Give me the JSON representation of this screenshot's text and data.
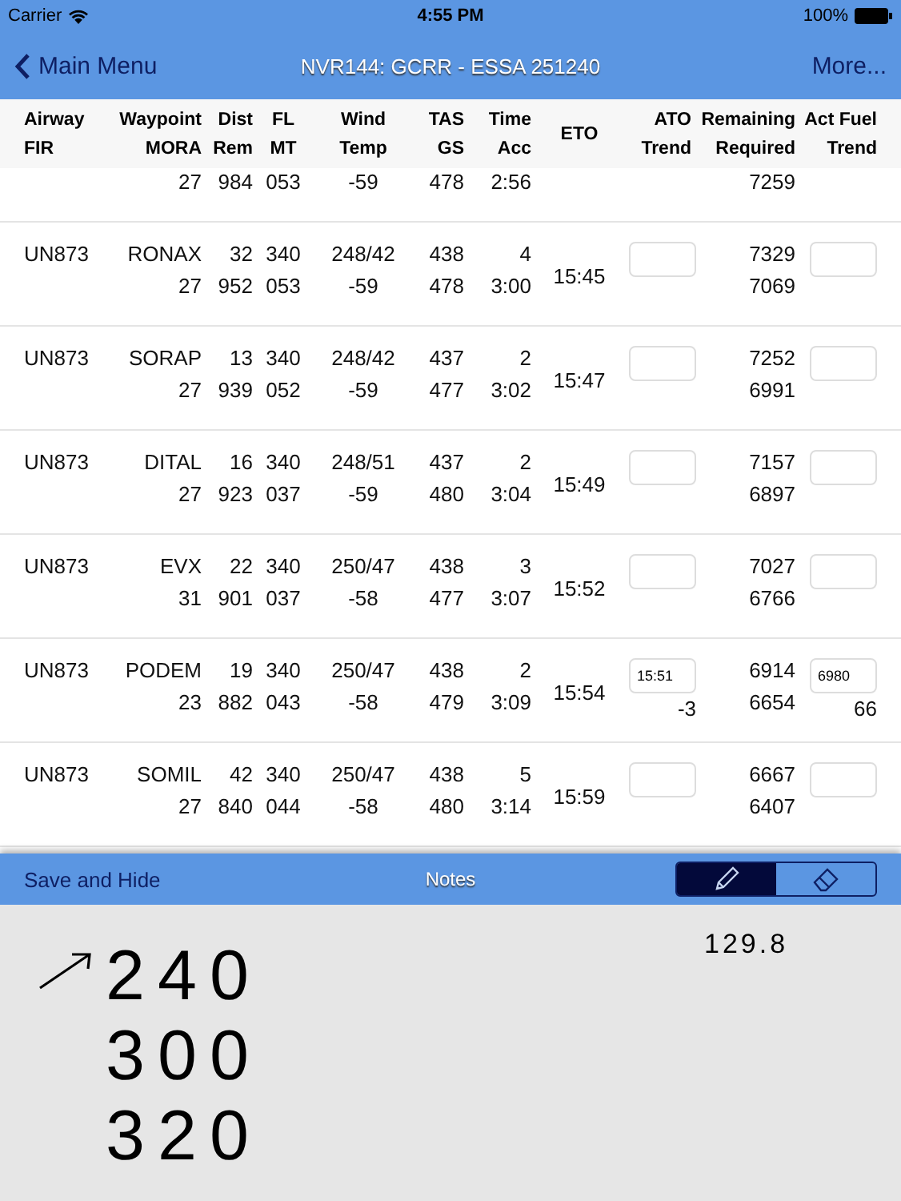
{
  "status_bar": {
    "carrier": "Carrier",
    "time": "4:55 PM",
    "battery": "100%"
  },
  "nav": {
    "back": "Main Menu",
    "title": "NVR144: GCRR - ESSA 251240",
    "more": "More..."
  },
  "columns": [
    {
      "top": "Airway",
      "bottom": "FIR"
    },
    {
      "top": "Waypoint",
      "bottom": "MORA"
    },
    {
      "top": "Dist",
      "bottom": "Rem"
    },
    {
      "top": "FL",
      "bottom": "MT"
    },
    {
      "top": "Wind",
      "bottom": "Temp"
    },
    {
      "top": "TAS",
      "bottom": "GS"
    },
    {
      "top": "Time",
      "bottom": "Acc"
    },
    {
      "top": "ETO"
    },
    {
      "top": "ATO",
      "bottom": "Trend"
    },
    {
      "top": "Remaining",
      "bottom": "Required"
    },
    {
      "top": "Act Fuel",
      "bottom": "Trend"
    }
  ],
  "clipped_row": {
    "mora": "27",
    "rem": "984",
    "mt": "053",
    "temp": "-59",
    "gs": "478",
    "acc": "2:56",
    "required": "7259"
  },
  "rows": [
    {
      "airway": "UN873",
      "waypoint": "RONAX",
      "mora": "27",
      "dist": "32",
      "rem": "952",
      "fl": "340",
      "mt": "053",
      "wind": "248/42",
      "temp": "-59",
      "tas": "438",
      "gs": "478",
      "time": "4",
      "acc": "3:00",
      "eto": "15:45",
      "remaining": "7329",
      "required": "7069"
    },
    {
      "airway": "UN873",
      "waypoint": "SORAP",
      "mora": "27",
      "dist": "13",
      "rem": "939",
      "fl": "340",
      "mt": "052",
      "wind": "248/42",
      "temp": "-59",
      "tas": "437",
      "gs": "477",
      "time": "2",
      "acc": "3:02",
      "eto": "15:47",
      "remaining": "7252",
      "required": "6991"
    },
    {
      "airway": "UN873",
      "waypoint": "DITAL",
      "mora": "27",
      "dist": "16",
      "rem": "923",
      "fl": "340",
      "mt": "037",
      "wind": "248/51",
      "temp": "-59",
      "tas": "437",
      "gs": "480",
      "time": "2",
      "acc": "3:04",
      "eto": "15:49",
      "remaining": "7157",
      "required": "6897"
    },
    {
      "airway": "UN873",
      "waypoint": "EVX",
      "mora": "31",
      "dist": "22",
      "rem": "901",
      "fl": "340",
      "mt": "037",
      "wind": "250/47",
      "temp": "-58",
      "tas": "438",
      "gs": "477",
      "time": "3",
      "acc": "3:07",
      "eto": "15:52",
      "remaining": "7027",
      "required": "6766"
    },
    {
      "airway": "UN873",
      "waypoint": "PODEM",
      "mora": "23",
      "dist": "19",
      "rem": "882",
      "fl": "340",
      "mt": "043",
      "wind": "250/47",
      "temp": "-58",
      "tas": "438",
      "gs": "479",
      "time": "2",
      "acc": "3:09",
      "eto": "15:54",
      "ato": "15:51",
      "ato_trend": "-3",
      "remaining": "6914",
      "required": "6654",
      "act_fuel": "6980",
      "fuel_trend": "66"
    },
    {
      "airway": "UN873",
      "waypoint": "SOMIL",
      "mora": "27",
      "dist": "42",
      "rem": "840",
      "fl": "340",
      "mt": "044",
      "wind": "250/47",
      "temp": "-58",
      "tas": "438",
      "gs": "480",
      "time": "5",
      "acc": "3:14",
      "eto": "15:59",
      "remaining": "6667",
      "required": "6407"
    }
  ],
  "toolbar": {
    "save": "Save and Hide",
    "title": "Notes",
    "tools": [
      {
        "kind": "pen",
        "selected": true
      },
      {
        "kind": "eraser",
        "selected": false
      }
    ]
  },
  "notes": {
    "ink": [
      "240",
      "300",
      "320"
    ],
    "side_note": "129.8"
  }
}
